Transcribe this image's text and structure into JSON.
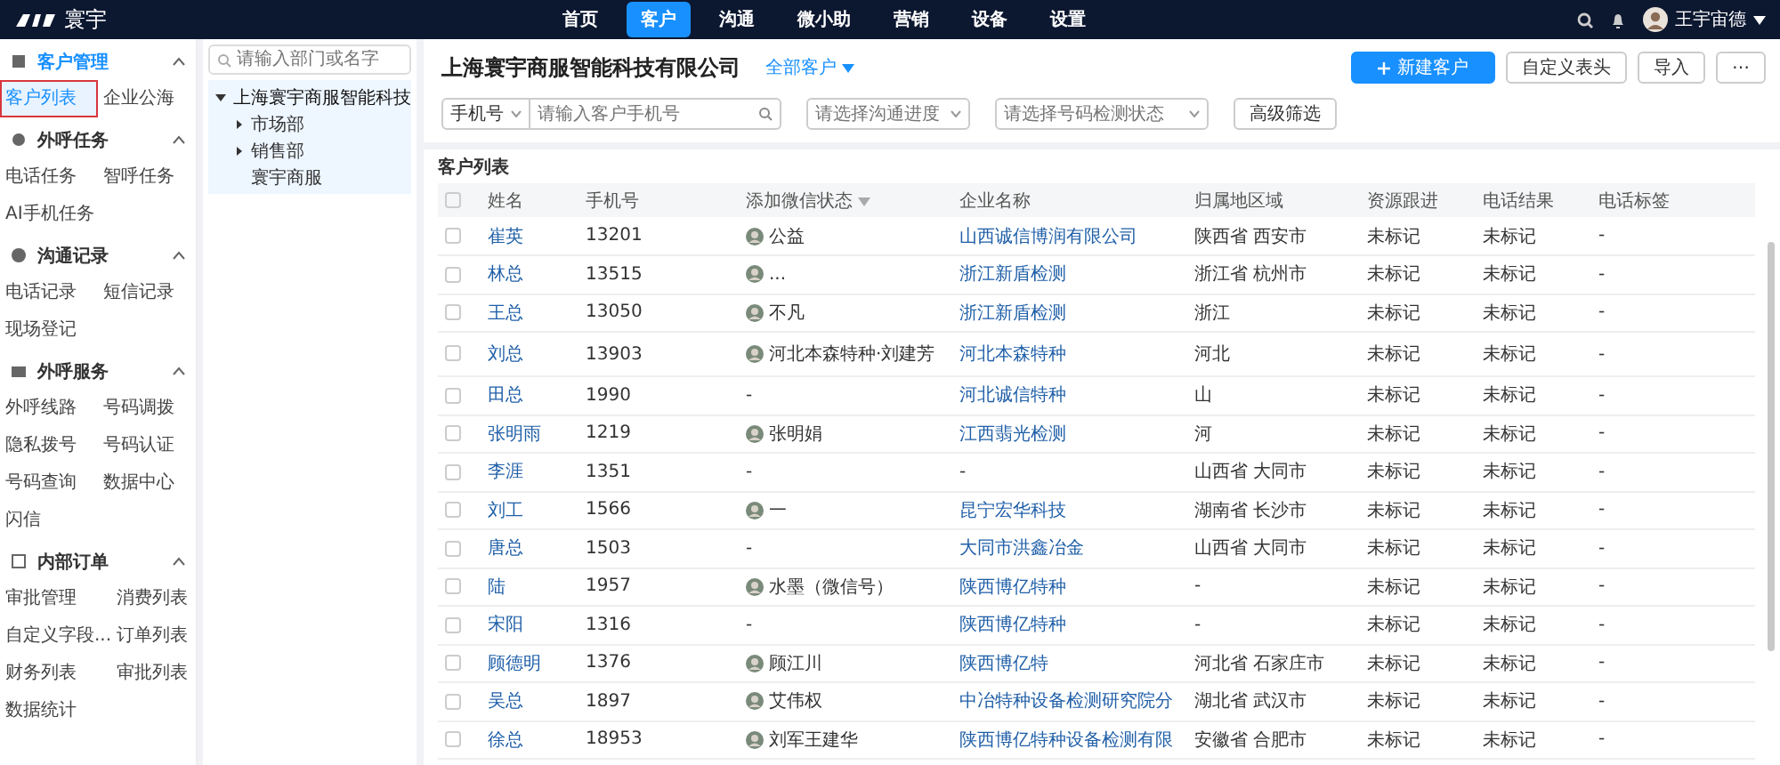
{
  "top_nav": {
    "logo": "寰宇",
    "items": [
      {
        "label": "首页",
        "selected": false
      },
      {
        "label": "客户",
        "selected": true
      },
      {
        "label": "沟通",
        "selected": false
      },
      {
        "label": "微小助",
        "selected": false
      },
      {
        "label": "营销",
        "selected": false
      },
      {
        "label": "设备",
        "selected": false
      },
      {
        "label": "设置",
        "selected": false
      }
    ],
    "user": "王宇宙德"
  },
  "sidebar": {
    "groups": [
      {
        "title": "客户管理",
        "expanded": true,
        "selected": true,
        "items": [
          {
            "label": "客户列表",
            "selected": true
          },
          {
            "label": "企业公海",
            "selected": false
          }
        ]
      },
      {
        "title": "外呼任务",
        "expanded": true,
        "selected": false,
        "items": [
          {
            "label": "电话任务",
            "selected": false
          },
          {
            "label": "智呼任务",
            "selected": false
          },
          {
            "label": "AI手机任务",
            "selected": false
          }
        ]
      },
      {
        "title": "沟通记录",
        "expanded": true,
        "selected": false,
        "items": [
          {
            "label": "电话记录",
            "selected": false
          },
          {
            "label": "短信记录",
            "selected": false
          },
          {
            "label": "现场登记",
            "selected": false
          }
        ]
      },
      {
        "title": "外呼服务",
        "expanded": true,
        "selected": false,
        "items": [
          {
            "label": "外呼线路",
            "selected": false
          },
          {
            "label": "号码调拨",
            "selected": false
          },
          {
            "label": "隐私拨号",
            "selected": false
          },
          {
            "label": "号码认证",
            "selected": false
          },
          {
            "label": "号码查询",
            "selected": false
          },
          {
            "label": "数据中心",
            "selected": false
          },
          {
            "label": "闪信",
            "selected": false
          }
        ]
      },
      {
        "title": "内部订单",
        "expanded": true,
        "selected": false,
        "items": [
          {
            "label": "审批管理",
            "selected": false
          },
          {
            "label": "消费列表",
            "selected": false
          },
          {
            "label": "自定义字段...",
            "selected": false
          },
          {
            "label": "订单列表",
            "selected": false
          },
          {
            "label": "财务列表",
            "selected": false
          },
          {
            "label": "审批列表",
            "selected": false
          },
          {
            "label": "数据统计",
            "selected": false
          }
        ]
      }
    ]
  },
  "tree": {
    "search_placeholder": "请输入部门或名字",
    "nodes": [
      {
        "label": "上海寰宇商服智能科技",
        "expanded": true,
        "selected": true,
        "children": [
          {
            "label": "市场部",
            "expanded": false,
            "selected": false
          },
          {
            "label": "销售部",
            "expanded": false,
            "selected": false
          },
          {
            "label": "寰宇商服",
            "selected": false
          }
        ]
      }
    ]
  },
  "header": {
    "company": "上海寰宇商服智能科技有限公司",
    "scope": "全部客户",
    "buttons": [
      {
        "label": "新建客户",
        "kind": "primary"
      },
      {
        "label": "自定义表头",
        "kind": "default"
      },
      {
        "label": "导入",
        "kind": "default"
      },
      {
        "label": "⋯",
        "kind": "default"
      }
    ]
  },
  "filters": {
    "field_type": "手机号",
    "phone_placeholder": "请输入客户手机号",
    "progress_placeholder": "请选择沟通进度",
    "status_placeholder": "请选择号码检测状态",
    "advanced": "高级筛选"
  },
  "table": {
    "title": "客户列表",
    "select_all_checked": false,
    "columns": [
      "姓名",
      "手机号",
      "添加微信状态",
      "企业名称",
      "归属地区域",
      "资源跟进",
      "电话结果",
      "电话标签"
    ],
    "rows": [
      {
        "checked": false,
        "name": "崔英",
        "phone": "13201",
        "avatar": true,
        "wechat": "公益",
        "company": "山西诚信博润有限公司",
        "region": "陕西省 西安市",
        "resource": "未标记",
        "result": "未标记",
        "tag": "-"
      },
      {
        "checked": false,
        "name": "林总",
        "phone": "13515",
        "avatar": true,
        "wechat": "...",
        "company": "浙江新盾检测",
        "region": "浙江省 杭州市",
        "resource": "未标记",
        "result": "未标记",
        "tag": "-"
      },
      {
        "checked": false,
        "name": "王总",
        "phone": "13050",
        "avatar": true,
        "wechat": "不凡",
        "company": "浙江新盾检测",
        "region": "浙江",
        "resource": "未标记",
        "result": "未标记",
        "tag": "-"
      },
      {
        "checked": false,
        "name": "刘总",
        "phone": "13903",
        "avatar": true,
        "wechat": "河北本森特种·刘建芳",
        "company": "河北本森特种",
        "region": "河北",
        "resource": "未标记",
        "result": "未标记",
        "tag": "-"
      },
      {
        "checked": false,
        "name": "田总",
        "phone": "1990",
        "avatar": false,
        "wechat": "-",
        "company": "河北诚信特种",
        "region": "山",
        "resource": "未标记",
        "result": "未标记",
        "tag": "-"
      },
      {
        "checked": false,
        "name": "张明雨",
        "phone": "1219",
        "avatar": true,
        "wechat": "张明娟",
        "company": "江西翡光检测",
        "region": "河",
        "resource": "未标记",
        "result": "未标记",
        "tag": "-"
      },
      {
        "checked": false,
        "name": "李涯",
        "phone": "1351",
        "avatar": false,
        "wechat": "-",
        "company": "-",
        "region": "山西省 大同市",
        "resource": "未标记",
        "result": "未标记",
        "tag": "-"
      },
      {
        "checked": false,
        "name": "刘工",
        "phone": "1566",
        "avatar": true,
        "wechat": "一",
        "company": "昆宁宏华科技",
        "region": "湖南省 长沙市",
        "resource": "未标记",
        "result": "未标记",
        "tag": "-"
      },
      {
        "checked": false,
        "name": "唐总",
        "phone": "1503",
        "avatar": false,
        "wechat": "-",
        "company": "大同市洪鑫冶金",
        "region": "山西省 大同市",
        "resource": "未标记",
        "result": "未标记",
        "tag": "-"
      },
      {
        "checked": false,
        "name": "陆",
        "phone": "1957",
        "avatar": true,
        "wechat": "水墨（微信号）",
        "company": "陕西博亿特种",
        "region": "-",
        "resource": "未标记",
        "result": "未标记",
        "tag": "-"
      },
      {
        "checked": false,
        "name": "宋阳",
        "phone": "1316",
        "avatar": false,
        "wechat": "-",
        "company": "陕西博亿特种",
        "region": "-",
        "resource": "未标记",
        "result": "未标记",
        "tag": "-"
      },
      {
        "checked": false,
        "name": "顾德明",
        "phone": "1376",
        "avatar": true,
        "wechat": "顾江川",
        "company": "陕西博亿特",
        "region": "河北省 石家庄市",
        "resource": "未标记",
        "result": "未标记",
        "tag": "-"
      },
      {
        "checked": false,
        "name": "吴总",
        "phone": "1897",
        "avatar": true,
        "wechat": "艾伟权",
        "company": "中冶特种设备检测研究院分",
        "region": "湖北省 武汉市",
        "resource": "未标记",
        "result": "未标记",
        "tag": "-"
      },
      {
        "checked": false,
        "name": "徐总",
        "phone": "18953",
        "avatar": true,
        "wechat": "刘军王建华",
        "company": "陕西博亿特种设备检测有限",
        "region": "安徽省 合肥市",
        "resource": "未标记",
        "result": "未标记",
        "tag": "-"
      }
    ]
  }
}
